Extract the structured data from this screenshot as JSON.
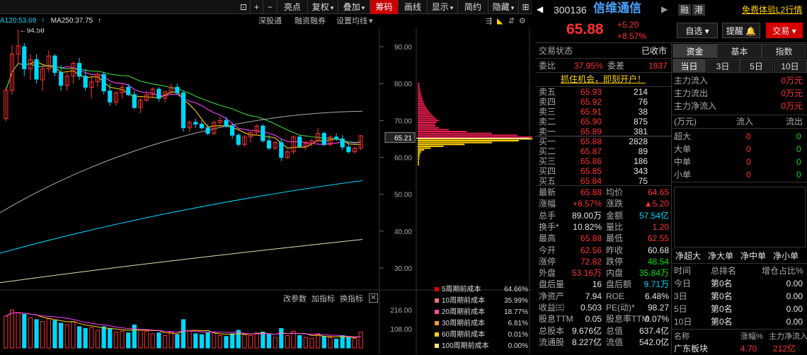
{
  "toolbar": {
    "items": [
      "亮点",
      "复权",
      "叠加",
      "筹码",
      "画线",
      "显示",
      "简约",
      "隐藏"
    ],
    "active_index": 3,
    "dropdown_flags": [
      false,
      true,
      true,
      false,
      false,
      true,
      false,
      true
    ]
  },
  "ma_legend": {
    "ma120": "A120:53.69",
    "ma250": "MA250:37.75"
  },
  "chart_links": {
    "shenguotong": "深股通",
    "rongzi": "融资融券",
    "junxian": "设置均线"
  },
  "chart_data": {
    "type": "candlestick",
    "price_axis": {
      "ticks": [
        90.0,
        80.0,
        70.0,
        60.0,
        50.0,
        40.0,
        30.0
      ],
      "range": [
        25,
        95
      ]
    },
    "current_price_label": "65.21",
    "high_marker": "94.58",
    "volume_axis": {
      "ticks": [
        "216.00",
        "108.00"
      ],
      "range": [
        0,
        240
      ]
    },
    "volume_tools": [
      "改参数",
      "加指标",
      "换指标"
    ],
    "candles": [
      [
        70.5,
        79.0,
        69.8,
        78.2
      ],
      [
        78.2,
        90.5,
        77.0,
        88.0
      ],
      [
        88,
        94.58,
        85,
        90.2
      ],
      [
        90,
        91,
        82,
        84
      ],
      [
        84,
        88,
        81,
        86.5
      ],
      [
        86.5,
        88,
        80,
        81.2
      ],
      [
        81,
        85,
        78,
        84
      ],
      [
        84,
        89,
        83,
        87.5
      ],
      [
        87.5,
        88,
        82,
        83
      ],
      [
        83,
        85,
        78,
        79.5
      ],
      [
        79.5,
        83,
        78,
        82
      ],
      [
        82,
        86,
        80,
        85.5
      ],
      [
        85.5,
        87,
        81,
        82
      ],
      [
        82,
        84,
        78,
        79
      ],
      [
        79,
        82,
        76,
        80.5
      ],
      [
        80.5,
        83,
        79,
        82.5
      ],
      [
        82.5,
        83,
        77,
        78
      ],
      [
        78,
        80,
        74,
        75
      ],
      [
        75,
        78,
        74,
        77.5
      ],
      [
        77.5,
        80,
        76,
        79
      ],
      [
        79,
        80,
        76.5,
        77
      ],
      [
        77,
        78,
        73,
        73.5
      ],
      [
        73.5,
        76,
        72,
        75.5
      ],
      [
        75.5,
        78,
        75,
        77
      ],
      [
        77,
        79,
        76,
        78.5
      ],
      [
        78.5,
        79,
        75,
        76
      ],
      [
        76,
        78,
        75,
        77.8
      ],
      [
        77.8,
        80,
        77,
        79
      ],
      [
        79,
        80,
        77,
        77.5
      ],
      [
        77.5,
        78,
        67,
        68
      ],
      [
        68,
        70,
        67,
        69.5
      ],
      [
        69.5,
        70.5,
        68,
        69
      ],
      [
        69,
        70,
        67.5,
        68
      ],
      [
        68,
        69,
        66,
        66.5
      ],
      [
        66.5,
        70,
        66,
        69.5
      ],
      [
        69.5,
        71,
        68,
        70
      ],
      [
        70,
        71,
        68,
        68.5
      ],
      [
        68.5,
        69,
        65,
        66
      ],
      [
        66,
        66.5,
        63,
        63.5
      ],
      [
        63.5,
        66,
        63,
        65.5
      ],
      [
        65.5,
        67,
        64,
        66.8
      ],
      [
        66.8,
        69,
        66,
        68.5
      ],
      [
        68.5,
        69,
        64,
        64.5
      ],
      [
        64.5,
        66,
        62,
        62.5
      ],
      [
        62.5,
        64.5,
        62,
        64
      ],
      [
        64,
        65,
        59,
        60
      ],
      [
        60,
        62,
        59.5,
        61.5
      ],
      [
        61.5,
        66,
        61,
        65.5
      ],
      [
        65.5,
        66,
        62.5,
        63
      ],
      [
        63,
        64.5,
        62,
        63.8
      ],
      [
        63.8,
        65,
        63,
        64.5
      ],
      [
        64.5,
        68,
        64,
        66.5
      ],
      [
        66.5,
        67,
        63,
        63.5
      ],
      [
        63.5,
        66,
        63,
        65.5
      ],
      [
        65.5,
        66.5,
        64.5,
        65
      ],
      [
        65,
        66,
        62,
        62.8
      ],
      [
        62.8,
        64,
        61,
        61.5
      ],
      [
        61.5,
        63,
        61,
        62.5
      ],
      [
        62.5,
        66,
        62,
        65.88
      ]
    ],
    "volumes": [
      [
        180,
        "up"
      ],
      [
        215,
        "up"
      ],
      [
        200,
        "up"
      ],
      [
        190,
        "down"
      ],
      [
        170,
        "up"
      ],
      [
        160,
        "down"
      ],
      [
        150,
        "up"
      ],
      [
        165,
        "up"
      ],
      [
        155,
        "down"
      ],
      [
        140,
        "down"
      ],
      [
        130,
        "up"
      ],
      [
        150,
        "up"
      ],
      [
        120,
        "down"
      ],
      [
        110,
        "down"
      ],
      [
        115,
        "up"
      ],
      [
        100,
        "up"
      ],
      [
        120,
        "down"
      ],
      [
        110,
        "down"
      ],
      [
        90,
        "up"
      ],
      [
        95,
        "up"
      ],
      [
        85,
        "down"
      ],
      [
        130,
        "down"
      ],
      [
        100,
        "up"
      ],
      [
        95,
        "up"
      ],
      [
        80,
        "up"
      ],
      [
        85,
        "down"
      ],
      [
        70,
        "up"
      ],
      [
        90,
        "up"
      ],
      [
        75,
        "down"
      ],
      [
        160,
        "down"
      ],
      [
        95,
        "up"
      ],
      [
        80,
        "down"
      ],
      [
        75,
        "down"
      ],
      [
        85,
        "down"
      ],
      [
        90,
        "up"
      ],
      [
        70,
        "up"
      ],
      [
        65,
        "down"
      ],
      [
        80,
        "down"
      ],
      [
        100,
        "down"
      ],
      [
        75,
        "up"
      ],
      [
        70,
        "up"
      ],
      [
        85,
        "up"
      ],
      [
        90,
        "down"
      ],
      [
        80,
        "down"
      ],
      [
        60,
        "up"
      ],
      [
        110,
        "down"
      ],
      [
        70,
        "up"
      ],
      [
        95,
        "up"
      ],
      [
        70,
        "down"
      ],
      [
        60,
        "up"
      ],
      [
        55,
        "up"
      ],
      [
        80,
        "up"
      ],
      [
        65,
        "down"
      ],
      [
        60,
        "up"
      ],
      [
        50,
        "down"
      ],
      [
        70,
        "down"
      ],
      [
        60,
        "down"
      ],
      [
        55,
        "up"
      ],
      [
        89,
        "up"
      ]
    ]
  },
  "chip_legend": [
    {
      "label": "5周期前成本",
      "value": "64.66%",
      "color": "#e60000"
    },
    {
      "label": "10周期前成本",
      "value": "35.99%",
      "color": "#ff7070"
    },
    {
      "label": "20周期前成本",
      "value": "18.77%",
      "color": "#ff4da6"
    },
    {
      "label": "30周期前成本",
      "value": "6.81%",
      "color": "#ff9933"
    },
    {
      "label": "60周期前成本",
      "value": "0.01%",
      "color": "#ffd200"
    },
    {
      "label": "100周期前成本",
      "value": "0.00%",
      "color": "#ffe680"
    }
  ],
  "stock": {
    "code": "300136",
    "name": "信维通信",
    "tags": [
      "融",
      "港"
    ],
    "promo": "免费体验L2行情",
    "price": "65.88",
    "change": "+5.20",
    "change_pct": "+8.57%",
    "btn_watch": "自选",
    "btn_alert": "提醒",
    "btn_trade": "交易"
  },
  "status": {
    "label": "交易状态",
    "value": "已收市"
  },
  "ratio": {
    "label1": "委比",
    "val1": "37.95%",
    "label2": "委差",
    "val2": "1937"
  },
  "promo_line": "抓住机会，即刻开户！",
  "asks": [
    {
      "label": "卖五",
      "price": "65.93",
      "vol": "214"
    },
    {
      "label": "卖四",
      "price": "65.92",
      "vol": "76"
    },
    {
      "label": "卖三",
      "price": "65.91",
      "vol": "38"
    },
    {
      "label": "卖二",
      "price": "65.90",
      "vol": "875"
    },
    {
      "label": "卖一",
      "price": "65.89",
      "vol": "381"
    }
  ],
  "bids": [
    {
      "label": "买一",
      "price": "65.88",
      "vol": "2828"
    },
    {
      "label": "买二",
      "price": "65.87",
      "vol": "89"
    },
    {
      "label": "买三",
      "price": "65.86",
      "vol": "186"
    },
    {
      "label": "买四",
      "price": "65.85",
      "vol": "343"
    },
    {
      "label": "买五",
      "price": "65.84",
      "vol": "75"
    }
  ],
  "quote": [
    [
      {
        "l": "最新",
        "v": "65.88",
        "c": "red"
      },
      {
        "l": "均价",
        "v": "64.65",
        "c": "red"
      }
    ],
    [
      {
        "l": "涨幅",
        "v": "+8.57%",
        "c": "red"
      },
      {
        "l": "涨跌",
        "v": "▲5.20",
        "c": "red"
      }
    ],
    [
      {
        "l": "总手",
        "v": "89.00万",
        "c": "white"
      },
      {
        "l": "金额",
        "v": "57.54亿",
        "c": "cyan"
      }
    ],
    [
      {
        "l": "换手*",
        "v": "10.82%",
        "c": "white"
      },
      {
        "l": "量比",
        "v": "1.20",
        "c": "red"
      }
    ],
    [
      {
        "l": "最高",
        "v": "65.88",
        "c": "red"
      },
      {
        "l": "最低",
        "v": "62.55",
        "c": "red"
      }
    ],
    [
      {
        "l": "今开",
        "v": "62.56",
        "c": "red"
      },
      {
        "l": "昨收",
        "v": "60.68",
        "c": "white"
      }
    ],
    [
      {
        "l": "涨停",
        "v": "72.82",
        "c": "red"
      },
      {
        "l": "跌停",
        "v": "48.54",
        "c": "green"
      }
    ],
    [
      {
        "l": "外盘",
        "v": "53.16万",
        "c": "red"
      },
      {
        "l": "内盘",
        "v": "35.84万",
        "c": "green"
      }
    ],
    [
      {
        "l": "盘后量",
        "v": "16",
        "c": "white"
      },
      {
        "l": "盘后额",
        "v": "9.71万",
        "c": "cyan"
      }
    ],
    [
      {
        "l": "净资产",
        "v": "7.94",
        "c": "white"
      },
      {
        "l": "ROE",
        "v": "6.48%",
        "c": "white"
      }
    ],
    [
      {
        "l": "收益㈢",
        "v": "0.503",
        "c": "white"
      },
      {
        "l": "PE(动)*",
        "v": "98.27",
        "c": "white"
      }
    ],
    [
      {
        "l": "股息TTM",
        "v": "0.05",
        "c": "white"
      },
      {
        "l": "股息率TTM",
        "v": "0.07%",
        "c": "white"
      }
    ],
    [
      {
        "l": "总股本",
        "v": "9.676亿",
        "c": "white"
      },
      {
        "l": "总值",
        "v": "637.4亿",
        "c": "white"
      }
    ],
    [
      {
        "l": "流通股",
        "v": "8.227亿",
        "c": "white"
      },
      {
        "l": "流值",
        "v": "542.0亿",
        "c": "white"
      }
    ]
  ],
  "fund_tabs": [
    "资金",
    "基本",
    "指数"
  ],
  "period_tabs": [
    "当日",
    "3日",
    "5日",
    "10日"
  ],
  "main_flow": [
    {
      "label": "主力流入",
      "value": "0万元"
    },
    {
      "label": "主力流出",
      "value": "0万元"
    },
    {
      "label": "主力净流入",
      "value": "0万元"
    }
  ],
  "flow_table": {
    "unit": "(万元)",
    "in": "流入",
    "out": "流出",
    "rows": [
      {
        "label": "超大",
        "in": "0",
        "out": "0"
      },
      {
        "label": "大单",
        "in": "0",
        "out": "0"
      },
      {
        "label": "中单",
        "in": "0",
        "out": "0"
      },
      {
        "label": "小单",
        "in": "0",
        "out": "0"
      }
    ]
  },
  "net_tabs": [
    "净超大",
    "净大单",
    "净中单",
    "净小单"
  ],
  "rank_table": {
    "headers": [
      "时间",
      "总排名",
      "增仓占比%"
    ],
    "rows": [
      {
        "t": "今日",
        "r": "第0名",
        "p": "0.00"
      },
      {
        "t": "3日",
        "r": "第0名",
        "p": "0.00"
      },
      {
        "t": "5日",
        "r": "第0名",
        "p": "0.00"
      },
      {
        "t": "10日",
        "r": "第0名",
        "p": "0.00"
      }
    ]
  },
  "sector": {
    "headers": [
      "名称",
      "涨幅%",
      "主力净流入"
    ],
    "row": {
      "name": "广东板块",
      "pct": "4.70",
      "flow": "212亿"
    }
  }
}
